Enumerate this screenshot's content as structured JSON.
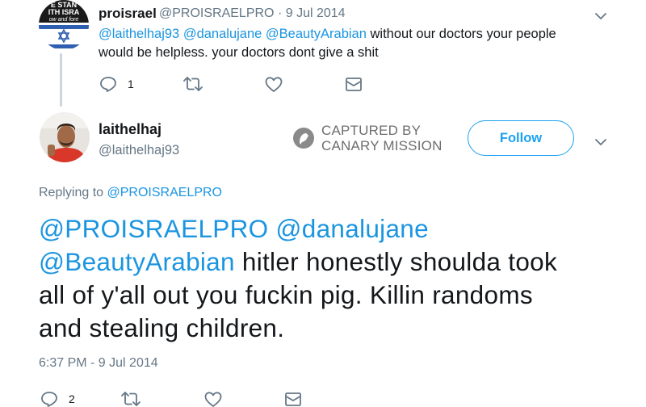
{
  "parent_tweet": {
    "avatar_text": [
      "E STAN",
      "ITH ISRA",
      "ow and fore"
    ],
    "display_name": "proisrael",
    "handle": "@PROISRAELPRO",
    "separator": "·",
    "date": "9 Jul 2014",
    "mentions": [
      "@laithelhaj93",
      "@danalujane",
      "@BeautyArabian"
    ],
    "text_line1": "without our doctors your people",
    "text_line2": "would be helpless. your doctors dont give a shit",
    "reply_count": "1"
  },
  "main_tweet": {
    "display_name": "laithelhaj",
    "handle": "@laithelhaj93",
    "watermark_line1": "CAPTURED BY",
    "watermark_line2": "CANARY MISSION",
    "follow_label": "Follow",
    "replying_prefix": "Replying to",
    "replying_handle": "@PROISRAELPRO",
    "mentions_line1": [
      "@PROISRAELPRO",
      "@danalujane"
    ],
    "mention_line2": "@BeautyArabian",
    "text_line2": "hitler honestly shoulda took",
    "text_line3": "all of y'all out you fuckin pig. Killin randoms",
    "text_line4": "and stealing children.",
    "timestamp": "6:37 PM - 9 Jul 2014",
    "reply_count": "2"
  },
  "colors": {
    "link": "#1b95e0",
    "follow": "#1da1f2",
    "muted": "#657786",
    "thread_line": "#ccd6dd"
  },
  "icons": [
    "reply-icon",
    "retweet-icon",
    "like-icon",
    "message-icon",
    "chevron-down-icon",
    "canary-logo-icon"
  ]
}
